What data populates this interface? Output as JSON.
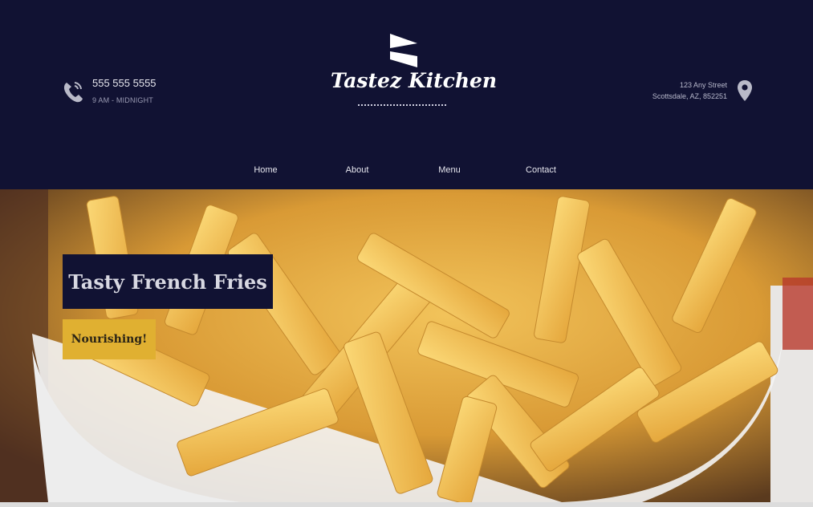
{
  "header": {
    "phone": {
      "number": "555 555 5555",
      "hours": "9 AM - MIDNIGHT",
      "icon": "phone-icon"
    },
    "logo": {
      "name": "Tastez Kitchen",
      "icon": "flag-logo-icon"
    },
    "address": {
      "line1": "123 Any Street",
      "line2": "Scottsdale, AZ, 852251",
      "icon": "map-pin-icon"
    }
  },
  "nav": {
    "items": [
      {
        "label": "Home"
      },
      {
        "label": "About"
      },
      {
        "label": "Menu"
      },
      {
        "label": "Contact"
      }
    ]
  },
  "hero": {
    "title": "Tasty French Fries",
    "button_label": "Nourishing!"
  },
  "colors": {
    "header_bg": "#111233",
    "accent": "#e0b031",
    "nav_text": "#e6e6ee"
  }
}
